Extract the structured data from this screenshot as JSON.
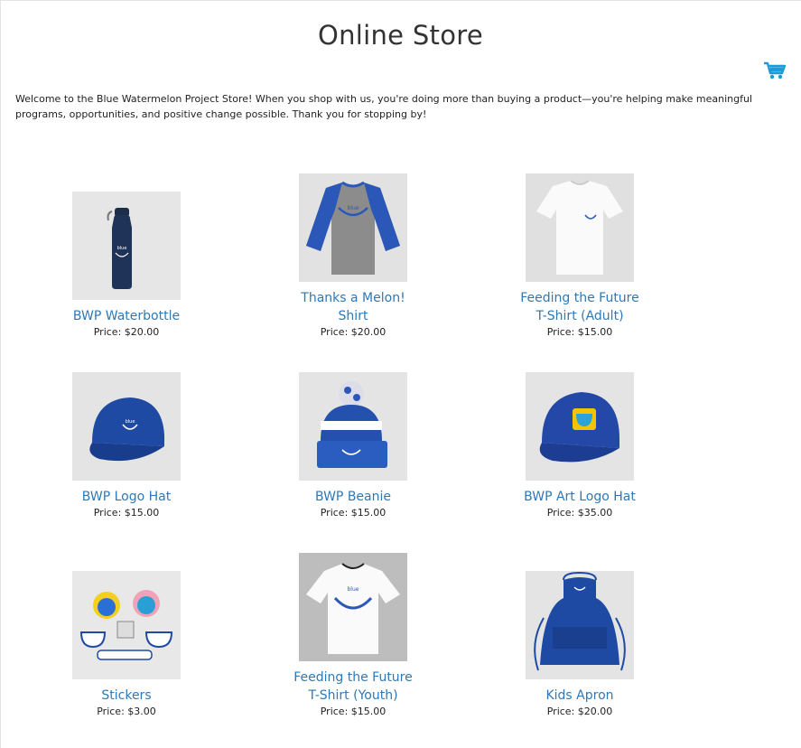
{
  "page": {
    "title": "Online Store",
    "intro": "Welcome to the Blue Watermelon Project Store! When you shop with us, you're doing more than buying a product—you're helping make meaningful programs, opportunities, and positive change possible. Thank you for stopping by!"
  },
  "header": {
    "cart_icon": "shopping-cart-icon",
    "accent_color": "#1e9ad6"
  },
  "products": [
    {
      "name": "BWP Waterbottle",
      "price": "Price: $20.00",
      "icon": "waterbottle"
    },
    {
      "name": "Thanks a Melon!\nShirt",
      "price": "Price: $20.00",
      "icon": "raglan-shirt"
    },
    {
      "name": "Feeding the Future\nT-Shirt (Adult)",
      "price": "Price: $15.00",
      "icon": "white-tshirt"
    },
    {
      "name": "BWP Logo Hat",
      "price": "Price: $15.00",
      "icon": "cap"
    },
    {
      "name": "BWP Beanie",
      "price": "Price: $15.00",
      "icon": "beanie"
    },
    {
      "name": "BWP Art Logo Hat",
      "price": "Price: $35.00",
      "icon": "trucker-hat"
    },
    {
      "name": "Stickers",
      "price": "Price: $3.00",
      "icon": "stickers"
    },
    {
      "name": "Feeding the Future\nT-Shirt (Youth)",
      "price": "Price: $15.00",
      "icon": "youth-tshirt"
    },
    {
      "name": "Kids Apron",
      "price": "Price: $20.00",
      "icon": "apron"
    }
  ],
  "colors": {
    "link": "#2f78b5",
    "brand_blue": "#1f4fa8",
    "text": "#333333"
  }
}
